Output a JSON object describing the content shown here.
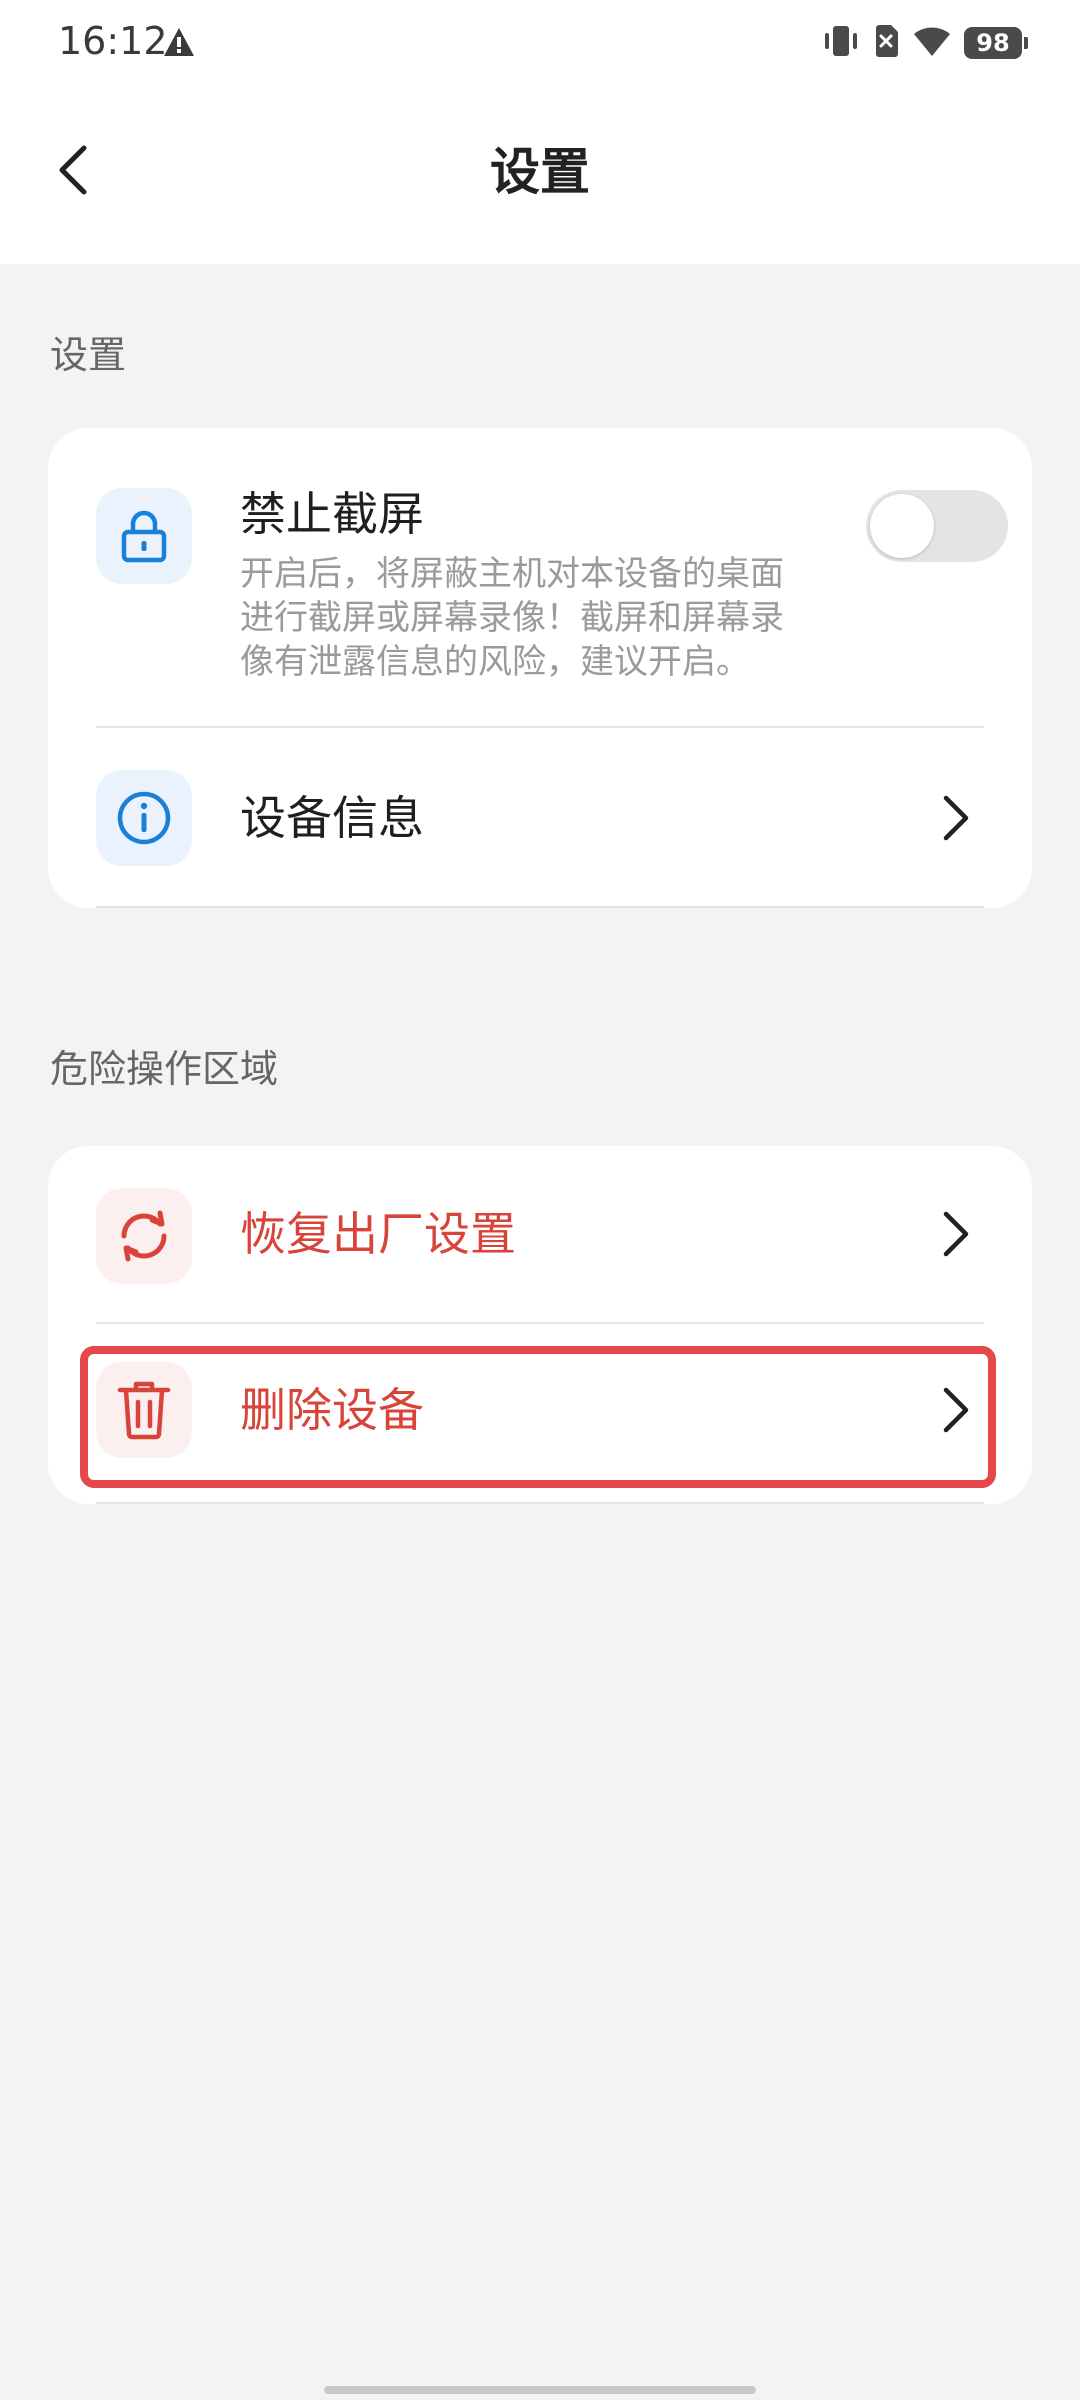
{
  "status_bar": {
    "time": "16:12",
    "battery": "98",
    "icons": [
      "warning-icon",
      "vibrate-icon",
      "no-sim-icon",
      "wifi-icon",
      "battery-icon"
    ]
  },
  "header": {
    "title": "设置",
    "back_icon": "chevron-left-icon"
  },
  "sections": {
    "settings": {
      "title": "设置",
      "items": [
        {
          "label": "禁止截屏",
          "description": "开启后，将屏蔽主机对本设备的桌面进行截屏或屏幕录像！截屏和屏幕录像有泄露信息的风险，建议开启。",
          "desc_lines": [
            "开启后，将屏蔽主机对本设备的桌面",
            "进行截屏或屏幕录像！截屏和屏幕录",
            "像有泄露信息的风险，建议开启。"
          ],
          "icon": "lock-icon",
          "toggle_on": false
        },
        {
          "label": "设备信息",
          "icon": "info-icon"
        }
      ]
    },
    "danger": {
      "title": "危险操作区域",
      "items": [
        {
          "label": "恢复出厂设置",
          "icon": "refresh-icon"
        },
        {
          "label": "删除设备",
          "icon": "trash-icon"
        }
      ]
    }
  },
  "colors": {
    "background": "#f2f3f5",
    "card": "#ffffff",
    "primary_blue": "#1a7fd8",
    "danger_red": "#d8433a",
    "highlight_red": "#e5484b"
  }
}
